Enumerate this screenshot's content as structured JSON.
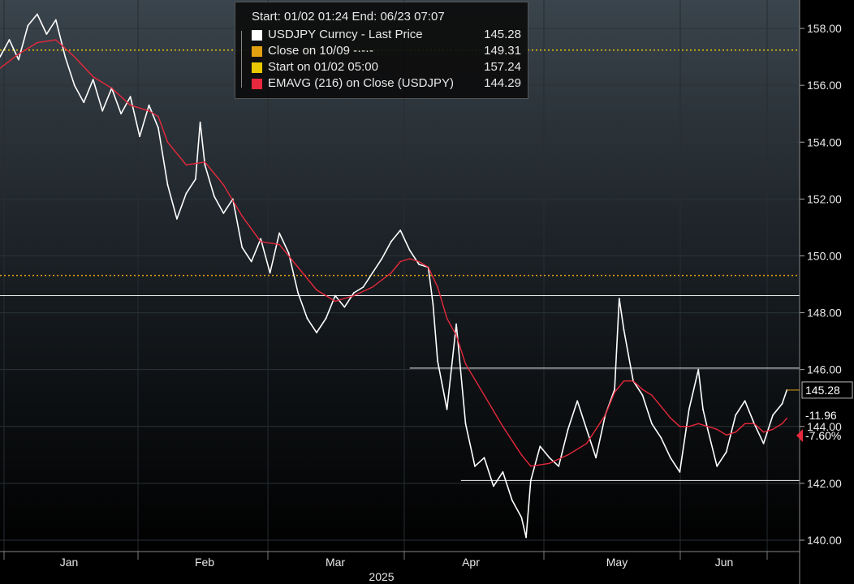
{
  "chart_data": {
    "type": "line",
    "header": {
      "start_label": "Start: 01/02 01:24",
      "end_label": "End: 06/23 07:07"
    },
    "legend": [
      {
        "label": "USDJPY Curncy - Last Price",
        "value": "145.28",
        "color": "#ffffff"
      },
      {
        "label": "Close on 10/09 -·-·-",
        "value": "149.31",
        "color": "#e0a010"
      },
      {
        "label": "Start on 01/02 05:00",
        "value": "157.24",
        "color": "#e8c800"
      },
      {
        "label": "EMAVG (216)  on Close (USDJPY)",
        "value": "144.29",
        "color": "#e8283c"
      }
    ],
    "x_ticks": [
      "Jan",
      "Feb",
      "Mar",
      "Apr",
      "May",
      "Jun"
    ],
    "x_year_label": "2025",
    "y_ticks": [
      "140.00",
      "142.00",
      "144.00",
      "146.00",
      "148.00",
      "150.00",
      "152.00",
      "154.00",
      "156.00",
      "158.00"
    ],
    "ylim": [
      139.6,
      159.0
    ],
    "xlim": [
      0,
      170
    ],
    "series": [
      {
        "name": "USDJPY Curncy - Last Price",
        "color": "#ffffff",
        "points": [
          [
            0,
            157.0
          ],
          [
            2,
            157.6
          ],
          [
            4,
            156.9
          ],
          [
            6,
            158.1
          ],
          [
            8,
            158.5
          ],
          [
            10,
            157.8
          ],
          [
            12,
            158.3
          ],
          [
            14,
            157.0
          ],
          [
            16,
            156.0
          ],
          [
            18,
            155.4
          ],
          [
            20,
            156.2
          ],
          [
            22,
            155.1
          ],
          [
            24,
            155.9
          ],
          [
            26,
            155.0
          ],
          [
            28,
            155.6
          ],
          [
            30,
            154.2
          ],
          [
            32,
            155.3
          ],
          [
            34,
            154.5
          ],
          [
            36,
            152.5
          ],
          [
            38,
            151.3
          ],
          [
            40,
            152.2
          ],
          [
            42,
            152.7
          ],
          [
            43,
            154.7
          ],
          [
            44,
            153.2
          ],
          [
            46,
            152.1
          ],
          [
            48,
            151.5
          ],
          [
            50,
            152.0
          ],
          [
            52,
            150.3
          ],
          [
            54,
            149.8
          ],
          [
            56,
            150.6
          ],
          [
            58,
            149.4
          ],
          [
            60,
            150.8
          ],
          [
            62,
            150.1
          ],
          [
            64,
            148.7
          ],
          [
            66,
            147.8
          ],
          [
            68,
            147.3
          ],
          [
            70,
            147.8
          ],
          [
            72,
            148.6
          ],
          [
            74,
            148.2
          ],
          [
            76,
            148.7
          ],
          [
            78,
            148.9
          ],
          [
            80,
            149.4
          ],
          [
            82,
            149.9
          ],
          [
            84,
            150.5
          ],
          [
            86,
            150.9
          ],
          [
            88,
            150.2
          ],
          [
            90,
            149.7
          ],
          [
            92,
            149.6
          ],
          [
            93,
            148.3
          ],
          [
            94,
            146.3
          ],
          [
            96,
            144.6
          ],
          [
            98,
            147.6
          ],
          [
            100,
            144.1
          ],
          [
            102,
            142.6
          ],
          [
            104,
            142.9
          ],
          [
            106,
            141.9
          ],
          [
            108,
            142.4
          ],
          [
            110,
            141.4
          ],
          [
            112,
            140.8
          ],
          [
            113,
            140.1
          ],
          [
            114,
            142.1
          ],
          [
            116,
            143.3
          ],
          [
            118,
            142.9
          ],
          [
            120,
            142.6
          ],
          [
            122,
            143.9
          ],
          [
            124,
            144.9
          ],
          [
            126,
            143.9
          ],
          [
            128,
            142.9
          ],
          [
            130,
            144.4
          ],
          [
            132,
            145.3
          ],
          [
            133,
            148.5
          ],
          [
            134,
            147.4
          ],
          [
            136,
            145.6
          ],
          [
            138,
            145.1
          ],
          [
            140,
            144.1
          ],
          [
            142,
            143.6
          ],
          [
            144,
            142.9
          ],
          [
            146,
            142.4
          ],
          [
            148,
            144.6
          ],
          [
            150,
            146.0
          ],
          [
            151,
            144.6
          ],
          [
            152,
            143.9
          ],
          [
            154,
            142.6
          ],
          [
            156,
            143.1
          ],
          [
            158,
            144.4
          ],
          [
            160,
            144.9
          ],
          [
            162,
            144.1
          ],
          [
            164,
            143.4
          ],
          [
            166,
            144.4
          ],
          [
            168,
            144.8
          ],
          [
            169,
            145.28
          ]
        ]
      },
      {
        "name": "EMAVG (216)  on Close (USDJPY)",
        "color": "#e8283c",
        "points": [
          [
            0,
            156.6
          ],
          [
            4,
            157.1
          ],
          [
            8,
            157.5
          ],
          [
            12,
            157.6
          ],
          [
            16,
            157.0
          ],
          [
            20,
            156.3
          ],
          [
            24,
            155.9
          ],
          [
            28,
            155.3
          ],
          [
            32,
            155.1
          ],
          [
            34,
            154.9
          ],
          [
            36,
            154.0
          ],
          [
            40,
            153.2
          ],
          [
            44,
            153.3
          ],
          [
            48,
            152.5
          ],
          [
            52,
            151.4
          ],
          [
            56,
            150.5
          ],
          [
            60,
            150.4
          ],
          [
            64,
            149.6
          ],
          [
            68,
            148.8
          ],
          [
            72,
            148.4
          ],
          [
            76,
            148.6
          ],
          [
            80,
            148.9
          ],
          [
            84,
            149.4
          ],
          [
            86,
            149.8
          ],
          [
            88,
            149.9
          ],
          [
            90,
            149.8
          ],
          [
            92,
            149.6
          ],
          [
            94,
            148.9
          ],
          [
            96,
            147.8
          ],
          [
            98,
            147.2
          ],
          [
            100,
            146.2
          ],
          [
            104,
            145.1
          ],
          [
            108,
            144.0
          ],
          [
            112,
            143.0
          ],
          [
            114,
            142.6
          ],
          [
            118,
            142.7
          ],
          [
            122,
            143.0
          ],
          [
            126,
            143.4
          ],
          [
            128,
            143.9
          ],
          [
            130,
            144.4
          ],
          [
            132,
            145.2
          ],
          [
            134,
            145.6
          ],
          [
            136,
            145.6
          ],
          [
            138,
            145.3
          ],
          [
            140,
            145.1
          ],
          [
            142,
            144.7
          ],
          [
            144,
            144.3
          ],
          [
            146,
            144.0
          ],
          [
            148,
            144.0
          ],
          [
            150,
            144.1
          ],
          [
            154,
            143.9
          ],
          [
            156,
            143.7
          ],
          [
            158,
            143.8
          ],
          [
            160,
            144.1
          ],
          [
            162,
            144.1
          ],
          [
            164,
            143.8
          ],
          [
            166,
            143.9
          ],
          [
            168,
            144.1
          ],
          [
            169,
            144.29
          ]
        ]
      }
    ],
    "reference_lines": [
      {
        "name": "Start on 01/02 05:00",
        "y": 157.24,
        "color": "#e8c800",
        "style": "dotted"
      },
      {
        "name": "Close on 10/09",
        "y": 149.31,
        "color": "#e0a010",
        "style": "dotted"
      }
    ],
    "horizontal_levels": [
      {
        "y": 148.6,
        "x_from": 0
      },
      {
        "y": 146.05,
        "x_from": 88
      },
      {
        "y": 142.1,
        "x_from": 99
      }
    ],
    "right_labels": [
      {
        "text": "145.28",
        "y": 145.28,
        "color": "#ffffff",
        "boxed": true
      },
      {
        "text": "-11.96",
        "y": 144.4,
        "color": "#ffffff",
        "boxed": false
      },
      {
        "text": "-7.60%",
        "y": 143.68,
        "color": "#ffffff",
        "boxed": false,
        "marker": "#e8283c"
      }
    ]
  }
}
